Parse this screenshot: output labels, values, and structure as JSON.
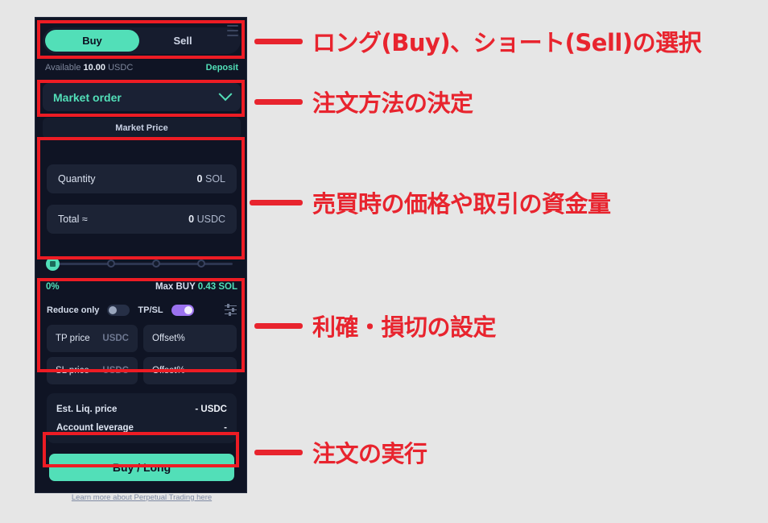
{
  "panel": {
    "side_tabs": {
      "buy_label": "Buy",
      "sell_label": "Sell",
      "menu_icon": "hamburger-icon",
      "active": "Buy"
    },
    "available": {
      "prefix": "Available",
      "amount": "10.00",
      "currency": "USDC",
      "deposit_label": "Deposit"
    },
    "order_type": {
      "value": "Market order",
      "chevron_icon": "chevron-down-icon"
    },
    "market_price_label": "Market Price",
    "quantity": {
      "label": "Quantity",
      "value": "0",
      "unit": "SOL"
    },
    "total": {
      "label": "Total ≈",
      "value": "0",
      "unit": "USDC"
    },
    "slider": {
      "percent": "0%",
      "stops": 4,
      "value": 0
    },
    "max": {
      "label": "Max BUY",
      "value": "0.43 SOL"
    },
    "toggles": {
      "reduce_only_label": "Reduce only",
      "reduce_only_on": false,
      "tpsl_label": "TP/SL",
      "tpsl_on": true,
      "settings_icon": "sliders-settings-icon"
    },
    "tpsl_fields": [
      {
        "label": "TP price",
        "unit": "USDC",
        "offset_placeholder": "Offset%"
      },
      {
        "label": "SL price",
        "unit": "USDC",
        "offset_placeholder": "Offset%"
      }
    ],
    "info_rows": [
      {
        "key": "Est. Liq. price",
        "value": "- USDC"
      },
      {
        "key": "Account leverage",
        "value": "-"
      }
    ],
    "submit_label": "Buy / Long",
    "learn_more_label": "Learn more about Perpetual Trading here"
  },
  "annotations": [
    {
      "text": "ロング(Buy)、ショート(Sell)の選択"
    },
    {
      "text": "注文方法の決定"
    },
    {
      "text": "売買時の価格や取引の資金量"
    },
    {
      "text": "利確・損切の設定"
    },
    {
      "text": "注文の実行"
    }
  ],
  "colors": {
    "accent_teal": "#52dfb8",
    "annotation_red": "#e8242e",
    "highlight_red": "#ed1c24",
    "panel_bg": "#0f1424",
    "page_bg": "#e6e6e6",
    "toggle_purple": "#9b72ef"
  }
}
